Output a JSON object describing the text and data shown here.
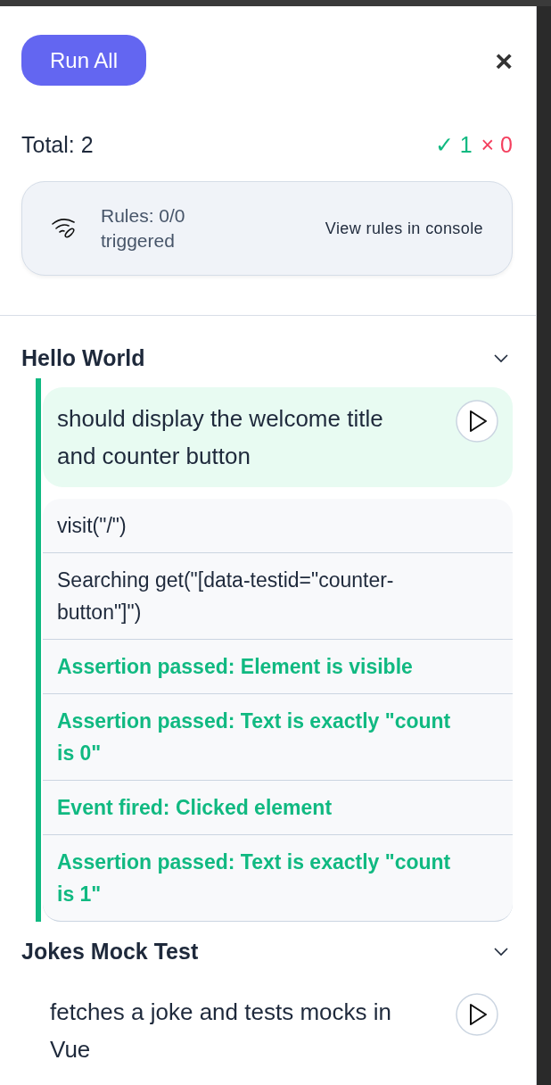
{
  "run_all_button": "Run All",
  "close_button": "×",
  "summary": {
    "total": "Total: 2",
    "passed_mark": "✓",
    "passed": "1",
    "failed_mark": "×",
    "failed": "0"
  },
  "rules": {
    "status": "Rules: 0/0 triggered",
    "link": "View rules in console"
  },
  "suites": [
    {
      "title": "Hello World",
      "expanded": true,
      "tests": [
        {
          "title": "should display the welcome title and counter button",
          "passed": true,
          "steps": [
            {
              "kind": "command",
              "text": "visit(\"/\")"
            },
            {
              "kind": "command",
              "text": "Searching get(\"[data-testid=\"counter-button\"]\")"
            },
            {
              "kind": "passed",
              "text": "Assertion passed: Element is visible"
            },
            {
              "kind": "passed",
              "text": "Assertion passed: Text is exactly \"count is 0\""
            },
            {
              "kind": "passed",
              "text": "Event fired: Clicked element"
            },
            {
              "kind": "passed",
              "text": "Assertion passed: Text is exactly \"count is 1\""
            }
          ]
        }
      ]
    },
    {
      "title": "Jokes Mock Test",
      "expanded": true,
      "tests": [
        {
          "title": "fetches a joke and tests mocks in Vue",
          "passed": false
        }
      ]
    }
  ]
}
